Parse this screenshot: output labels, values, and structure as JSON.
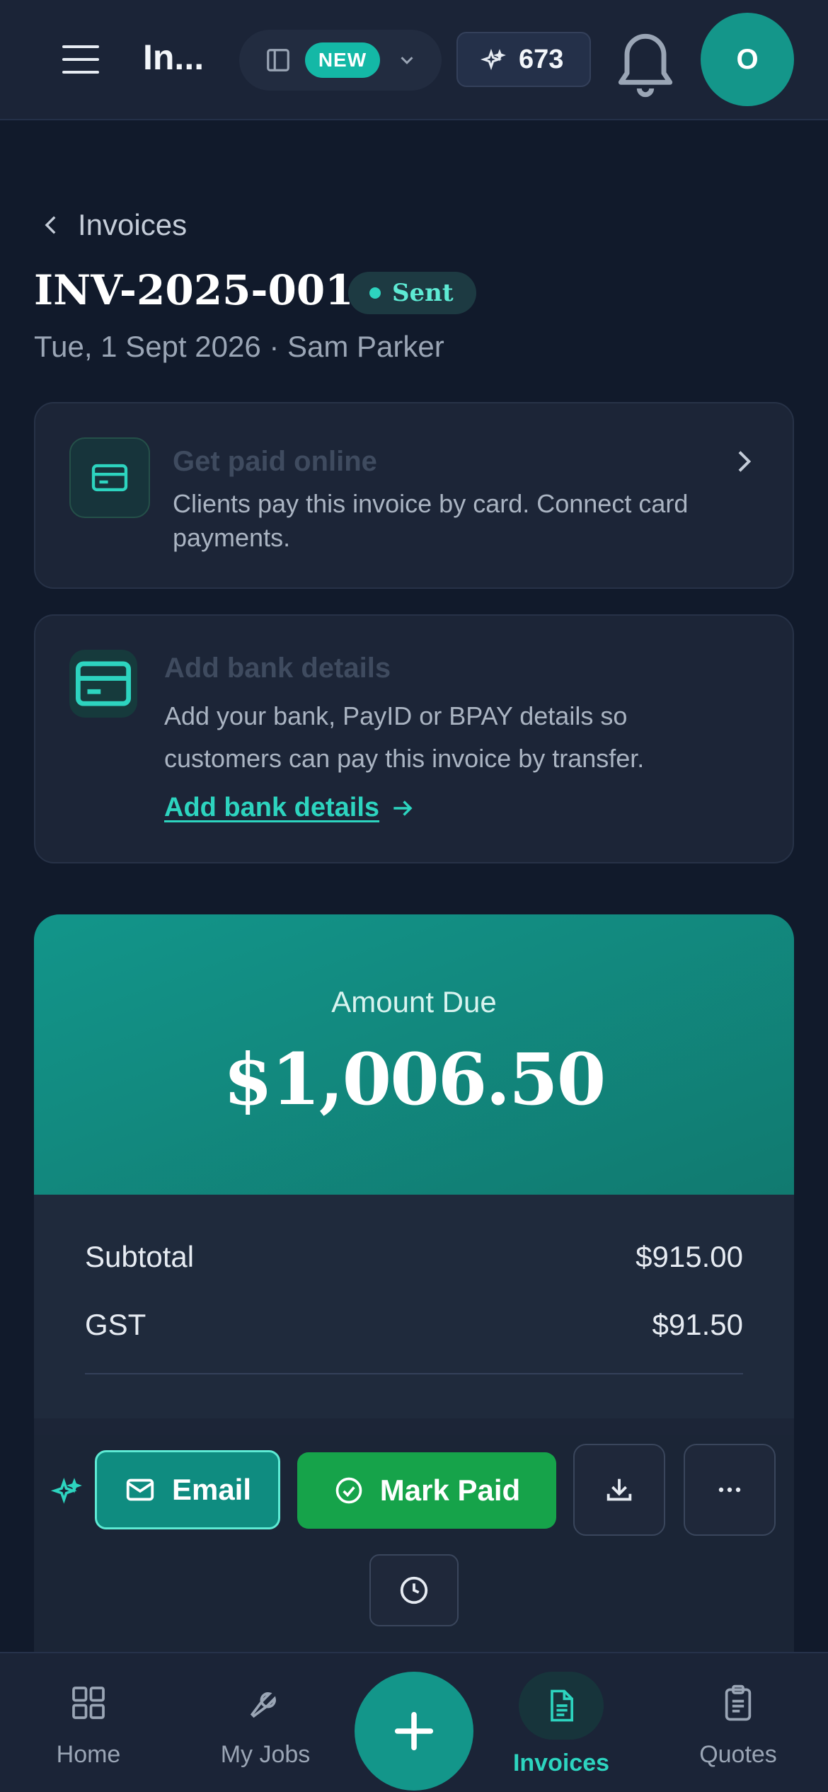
{
  "topbar": {
    "title": "In...",
    "new_badge": "NEW",
    "credits": "673",
    "avatar_initial": "O"
  },
  "header": {
    "back_label": "Invoices",
    "invoice_number": "INV-2025-0019",
    "status": "Sent",
    "subtitle": "Tue, 1 Sept 2026 · Sam Parker"
  },
  "online_payment_card": {
    "title": "Get paid online",
    "description": "Clients pay this invoice by card. Connect card payments."
  },
  "bank_card": {
    "title": "Add bank details",
    "description": "Add your bank, PayID or BPAY details so customers can pay this invoice by transfer.",
    "link_label": "Add bank details"
  },
  "amount": {
    "label": "Amount Due",
    "value": "$1,006.50"
  },
  "totals": {
    "subtotal_label": "Subtotal",
    "subtotal_value": "$915.00",
    "gst_label": "GST",
    "gst_value": "$91.50"
  },
  "actions": {
    "email_label": "Email",
    "mark_paid_label": "Mark Paid"
  },
  "nav": {
    "home": "Home",
    "jobs": "My Jobs",
    "invoices": "Invoices",
    "quotes": "Quotes"
  },
  "colors": {
    "accent": "#14b8a6",
    "mark_paid": "#16a34a",
    "background": "#111a2b"
  }
}
